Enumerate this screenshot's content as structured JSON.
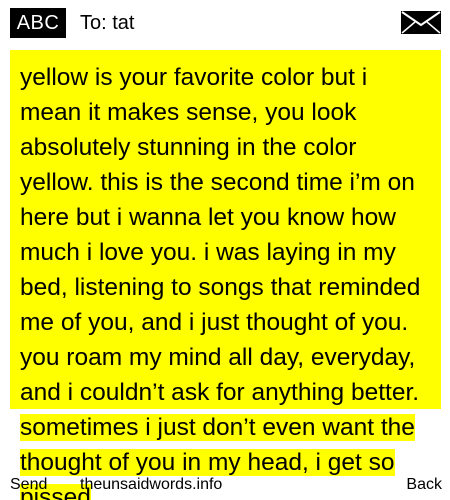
{
  "header": {
    "input_mode": "ABC",
    "to_label": "To: tat",
    "message_icon": "envelope-icon"
  },
  "message": {
    "text": "yellow is your favorite color but i mean it makes sense, you look absolutely stunning in the color yellow. this is the second time i’m on here but i wanna let you know how much i love you. i was laying in my bed, listening to songs that reminded me of you, and i just thought of you. you roam my mind all day, everyday, and i couldn’t ask for anything better. sometimes i just don’t even want the thought of you in my head, i get so pissed"
  },
  "footer": {
    "send_label": "Send",
    "site_label": "theunsaidwords.info",
    "back_label": "Back"
  },
  "colors": {
    "highlight": "#ffff00",
    "text": "#000000",
    "background": "#ffffff"
  }
}
